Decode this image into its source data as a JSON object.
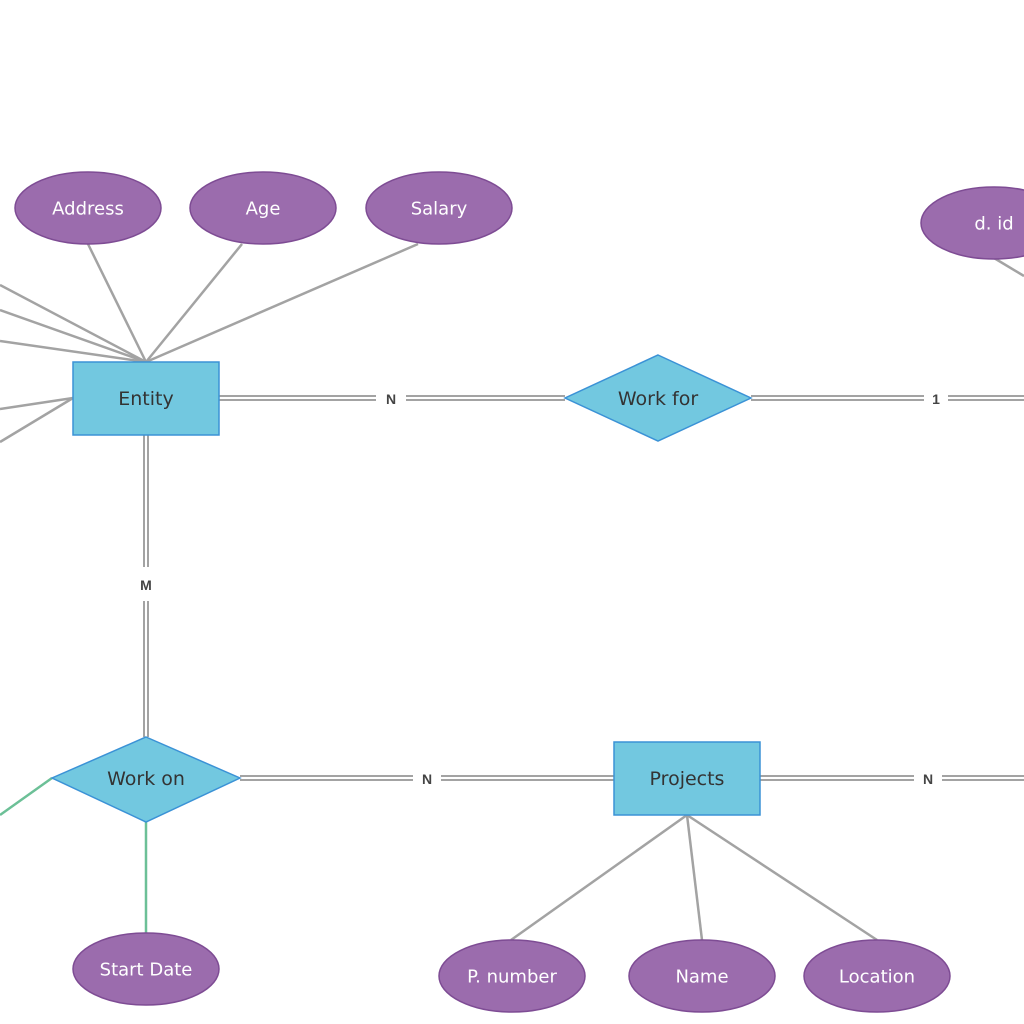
{
  "diagram": {
    "type": "ER diagram",
    "entities": [
      {
        "id": "entity",
        "label": "Entity"
      },
      {
        "id": "projects",
        "label": "Projects"
      }
    ],
    "relationships": [
      {
        "id": "work_for",
        "label": "Work for"
      },
      {
        "id": "work_on",
        "label": "Work on"
      }
    ],
    "attributes": [
      {
        "id": "address",
        "label": "Address",
        "of": "entity"
      },
      {
        "id": "age",
        "label": "Age",
        "of": "entity"
      },
      {
        "id": "salary",
        "label": "Salary",
        "of": "entity"
      },
      {
        "id": "d_id",
        "label": "d. id",
        "of": "offscreen-right"
      },
      {
        "id": "start_date",
        "label": "Start Date",
        "of": "work_on"
      },
      {
        "id": "p_number",
        "label": "P. number",
        "of": "projects"
      },
      {
        "id": "name",
        "label": "Name",
        "of": "projects"
      },
      {
        "id": "location",
        "label": "Location",
        "of": "projects"
      }
    ],
    "cardinalities": [
      {
        "id": "entity_workfor",
        "label": "N",
        "between": [
          "entity",
          "work_for"
        ]
      },
      {
        "id": "workfor_right",
        "label": "1",
        "between": [
          "work_for",
          "offscreen-right"
        ]
      },
      {
        "id": "entity_workon",
        "label": "M",
        "between": [
          "entity",
          "work_on"
        ]
      },
      {
        "id": "workon_projects",
        "label": "N",
        "between": [
          "work_on",
          "projects"
        ]
      },
      {
        "id": "projects_right",
        "label": "N",
        "between": [
          "projects",
          "offscreen-right"
        ]
      }
    ]
  },
  "labels": {
    "entity": "Entity",
    "projects": "Projects",
    "work_for": "Work for",
    "work_on": "Work on",
    "address": "Address",
    "age": "Age",
    "salary": "Salary",
    "d_id": "d. id",
    "start_date": "Start Date",
    "p_number": "P. number",
    "name": "Name",
    "location": "Location",
    "card_entity_workfor": "N",
    "card_workfor_right": "1",
    "card_entity_workon": "M",
    "card_workon_projects": "N",
    "card_projects_right": "N"
  },
  "colors": {
    "attribute_fill": "#9b6cad",
    "entity_fill": "#72c8e0",
    "entity_stroke": "#3b92d6",
    "connector": "#a3a3a3",
    "relationship_attr_connector": "#6cc097"
  }
}
